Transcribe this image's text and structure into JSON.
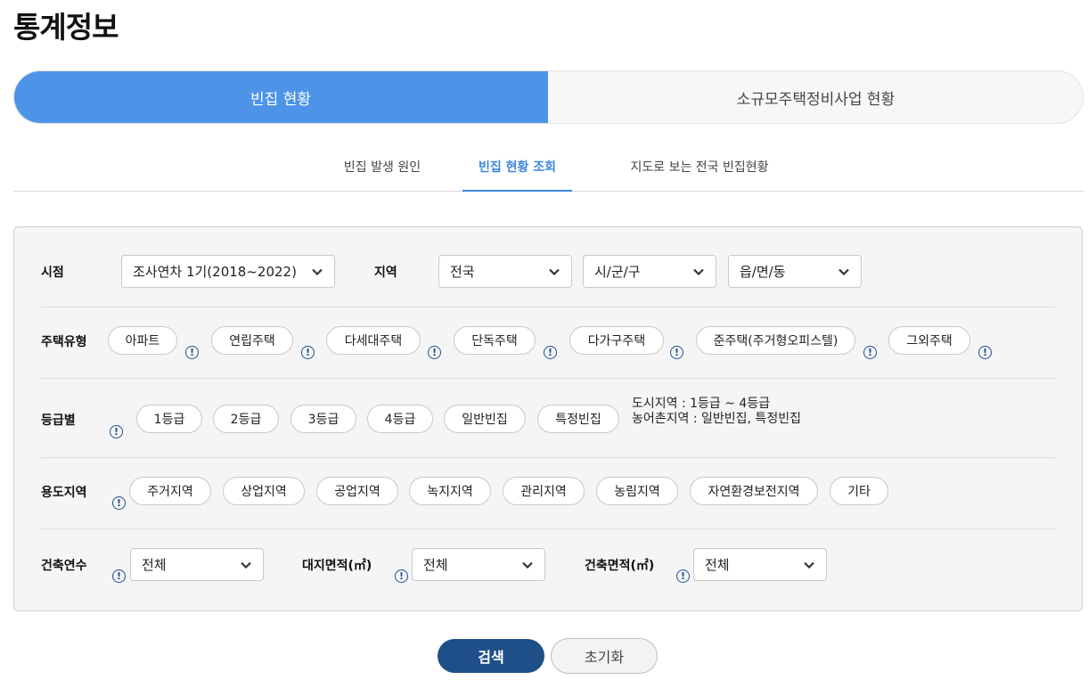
{
  "page": {
    "title": "통계정보"
  },
  "main_tabs": [
    {
      "label": "빈집 현황"
    },
    {
      "label": "소규모주택정비사업 현황"
    }
  ],
  "sub_tabs": [
    {
      "label": "빈집 발생 원인"
    },
    {
      "label": "빈집 현황 조회"
    },
    {
      "label": "지도로 보는 전국 빈집현황"
    }
  ],
  "filters": {
    "period": {
      "label": "시점",
      "value": "조사연차 1기(2018~2022)"
    },
    "region": {
      "label": "지역",
      "sido": "전국",
      "sigungu": "시/군/구",
      "dong": "읍/면/동"
    },
    "housing_type": {
      "label": "주택유형",
      "options": [
        "아파트",
        "연립주택",
        "다세대주택",
        "단독주택",
        "다가구주택",
        "준주택(주거형오피스텔)",
        "그외주택"
      ]
    },
    "grade": {
      "label": "등급별",
      "options": [
        "1등급",
        "2등급",
        "3등급",
        "4등급",
        "일반빈집",
        "특정빈집"
      ],
      "note_urban": "도시지역 : 1등급 ~ 4등급",
      "note_rural": "농어촌지역 : 일반빈집, 특정빈집"
    },
    "zoning": {
      "label": "용도지역",
      "options": [
        "주거지역",
        "상업지역",
        "공업지역",
        "녹지지역",
        "관리지역",
        "농림지역",
        "자연환경보전지역",
        "기타"
      ]
    },
    "building_age": {
      "label": "건축연수",
      "value": "전체"
    },
    "land_area": {
      "label": "대지면적(㎡)",
      "value": "전체"
    },
    "floor_area": {
      "label": "건축면적(㎡)",
      "value": "전체"
    }
  },
  "info_icon": "!",
  "icons": {
    "dropdown": "chevron-down-icon",
    "info": "info-icon"
  },
  "colors": {
    "accent": "#4d94e8",
    "primary_button": "#1f4f88",
    "active_subtab": "#3d86dc"
  },
  "actions": {
    "search_label": "검색",
    "reset_label": "초기화"
  }
}
